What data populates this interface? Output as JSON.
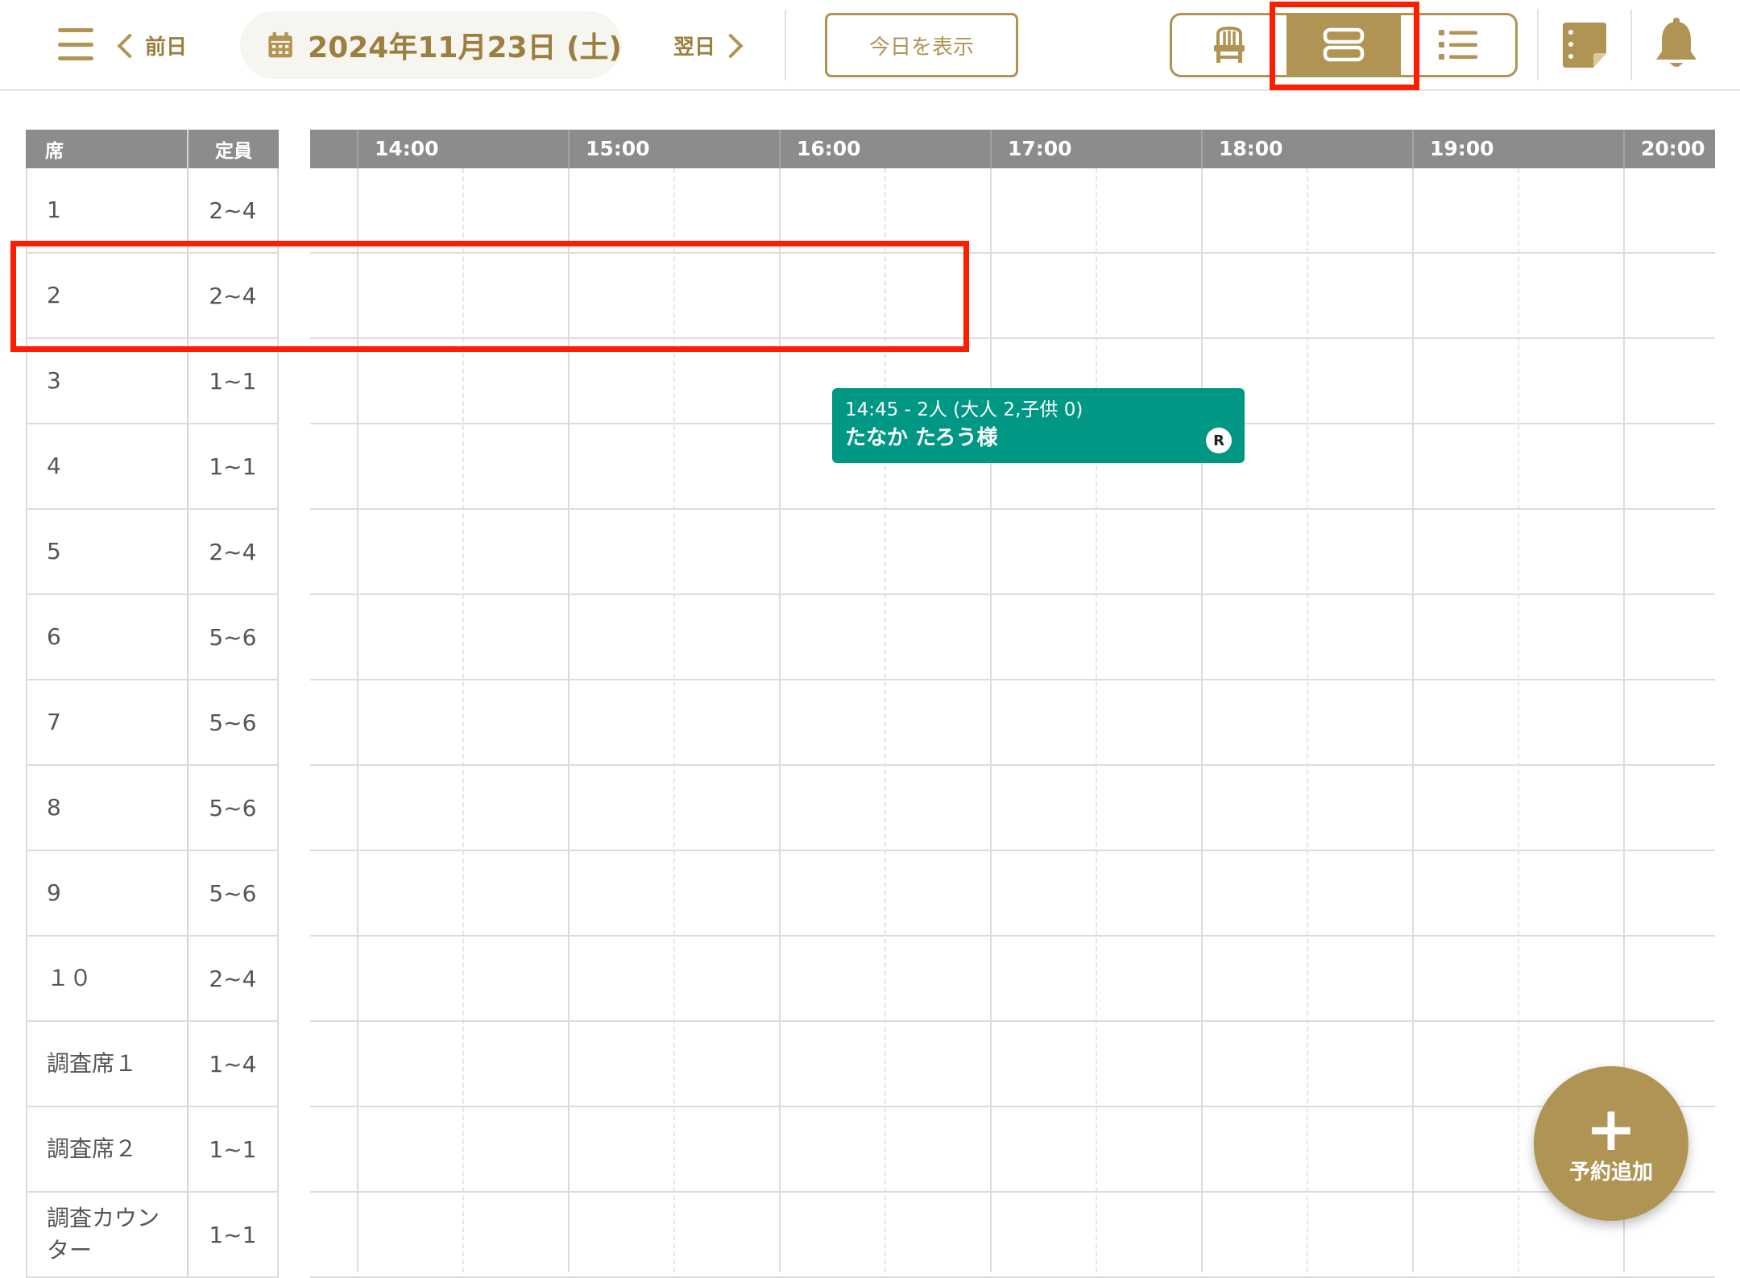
{
  "header": {
    "prev_label": "前日",
    "next_label": "翌日",
    "date": "2024年11月23日 (土)",
    "today_label": "今日を表示"
  },
  "seats": {
    "col_seat": "席",
    "col_capacity": "定員",
    "rows": [
      {
        "name": "1",
        "cap": "2~4"
      },
      {
        "name": "2",
        "cap": "2~4"
      },
      {
        "name": "3",
        "cap": "1~1"
      },
      {
        "name": "4",
        "cap": "1~1"
      },
      {
        "name": "5",
        "cap": "2~4"
      },
      {
        "name": "6",
        "cap": "5~6"
      },
      {
        "name": "7",
        "cap": "5~6"
      },
      {
        "name": "8",
        "cap": "5~6"
      },
      {
        "name": "9",
        "cap": "5~6"
      },
      {
        "name": "１０",
        "cap": "2~4"
      },
      {
        "name": "調査席１",
        "cap": "1~4"
      },
      {
        "name": "調査席２",
        "cap": "1~1"
      },
      {
        "name": "調査カウンター",
        "cap": "1~1"
      }
    ]
  },
  "timeline": {
    "hours": [
      "14:00",
      "15:00",
      "16:00",
      "17:00",
      "18:00",
      "19:00",
      "20:00"
    ]
  },
  "reservation": {
    "time_line": "14:45 - 2人 (大人 2,子供 0)",
    "name": "たなか たろう様",
    "badge": "R"
  },
  "fab": {
    "plus": "+",
    "label": "予約追加"
  }
}
